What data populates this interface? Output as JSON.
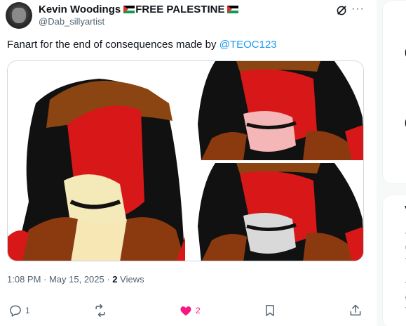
{
  "author": {
    "name": "Kevin Woodings",
    "name_suffix": "FREE PALESTINE",
    "handle": "@Dab_sillyartist"
  },
  "tweet": {
    "text": "Fanart for the end of consequences made by ",
    "mention": "@TEOC123"
  },
  "meta": {
    "timestamp": "1:08 PM · May 15, 2025 · ",
    "views_count": "2",
    "views_label": " Views"
  },
  "actions": {
    "reply_count": "1",
    "retweet_count": "",
    "like_count": "2"
  },
  "icons": {
    "grok": "grok-icon",
    "more": "more-icon",
    "reply": "reply-icon",
    "retweet": "retweet-icon",
    "like": "heart-icon",
    "bookmark": "bookmark-icon",
    "share": "share-icon",
    "flag": "palestine-flag-icon"
  },
  "colors": {
    "accent": "#1d9bf0",
    "like": "#f91880",
    "muted": "#536471"
  },
  "right_panel": {
    "glyph1": "(",
    "glyph2": "(",
    "letter": "V",
    "small": [
      "T",
      "U",
      "T",
      "T",
      "#",
      "T"
    ]
  }
}
